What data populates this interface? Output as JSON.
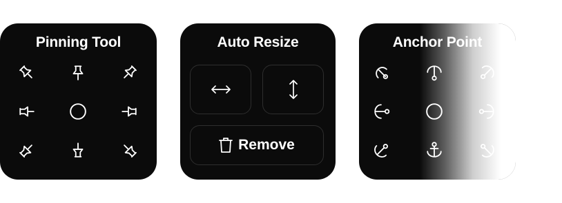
{
  "pinning_tool": {
    "title": "Pinning Tool",
    "icons": [
      "pin-top-left-icon",
      "pin-top-icon",
      "pin-top-right-icon",
      "pin-left-icon",
      "circle-center-icon",
      "pin-right-icon",
      "pin-bottom-left-icon",
      "pin-bottom-icon",
      "pin-bottom-right-icon"
    ]
  },
  "auto_resize": {
    "title": "Auto Resize",
    "horizontal_icon": "arrows-horizontal-icon",
    "vertical_icon": "arrows-vertical-icon",
    "remove_label": "Remove",
    "remove_icon": "trash-icon"
  },
  "anchor_point": {
    "title": "Anchor Point",
    "icons": [
      "anchor-top-left-icon",
      "anchor-top-icon",
      "anchor-top-right-icon",
      "anchor-left-icon",
      "circle-center-icon",
      "anchor-right-icon",
      "anchor-bottom-left-icon",
      "anchor-bottom-icon",
      "anchor-bottom-right-icon"
    ]
  },
  "colors": {
    "panel_bg": "#0b0b0b",
    "border": "#2e2e2e",
    "foreground": "#ffffff"
  }
}
